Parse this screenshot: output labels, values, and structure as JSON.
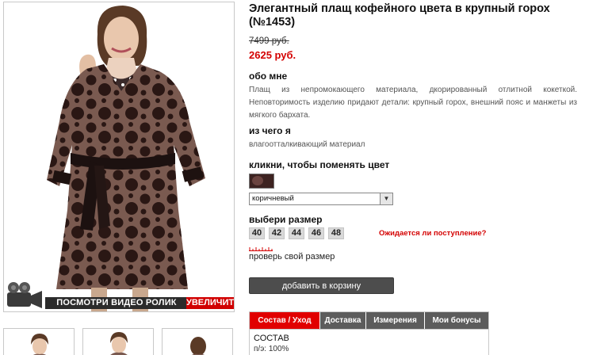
{
  "product": {
    "title": "Элегантный плащ кофейного цвета в крупный горох (№1453)",
    "old_price": "7499 руб.",
    "new_price": "2625 руб."
  },
  "about": {
    "heading": "обо мне",
    "text": "Плащ из непромокающего материала, дкорированный отлитной кокеткой. Неповторимость изделию придают детали: крупный горох, внешний пояс и манжеты из мягкого бархата."
  },
  "material": {
    "heading": "из чего я",
    "text": "влагоотталкивающий материал"
  },
  "color": {
    "heading": "кликни, чтобы поменять цвет",
    "swatch_color": "#3d2321",
    "selected": "коричневый"
  },
  "size": {
    "heading": "выбери размер",
    "options": [
      "40",
      "42",
      "44",
      "46",
      "48"
    ],
    "waiting_link": "Ожидается ли поступление?",
    "check_link": "проверь свой размер"
  },
  "cart": {
    "button_label": "добавить в корзину"
  },
  "media": {
    "video_label": "ПОСМОТРИ ВИДЕО РОЛИК",
    "zoom_label": "УВЕЛИЧИТЬ"
  },
  "tabs": {
    "items": [
      "Состав / Уход",
      "Доставка",
      "Измерения",
      "Мои бонусы"
    ],
    "active_index": 0,
    "content_title": "СОСТАВ",
    "content_text": "п/э: 100%"
  },
  "colors": {
    "accent_red": "#d40000",
    "tab_active": "#e10000",
    "tab_inactive": "#5c5c5c",
    "button": "#4d4d4d",
    "coat_brown": "#7a5a50"
  }
}
